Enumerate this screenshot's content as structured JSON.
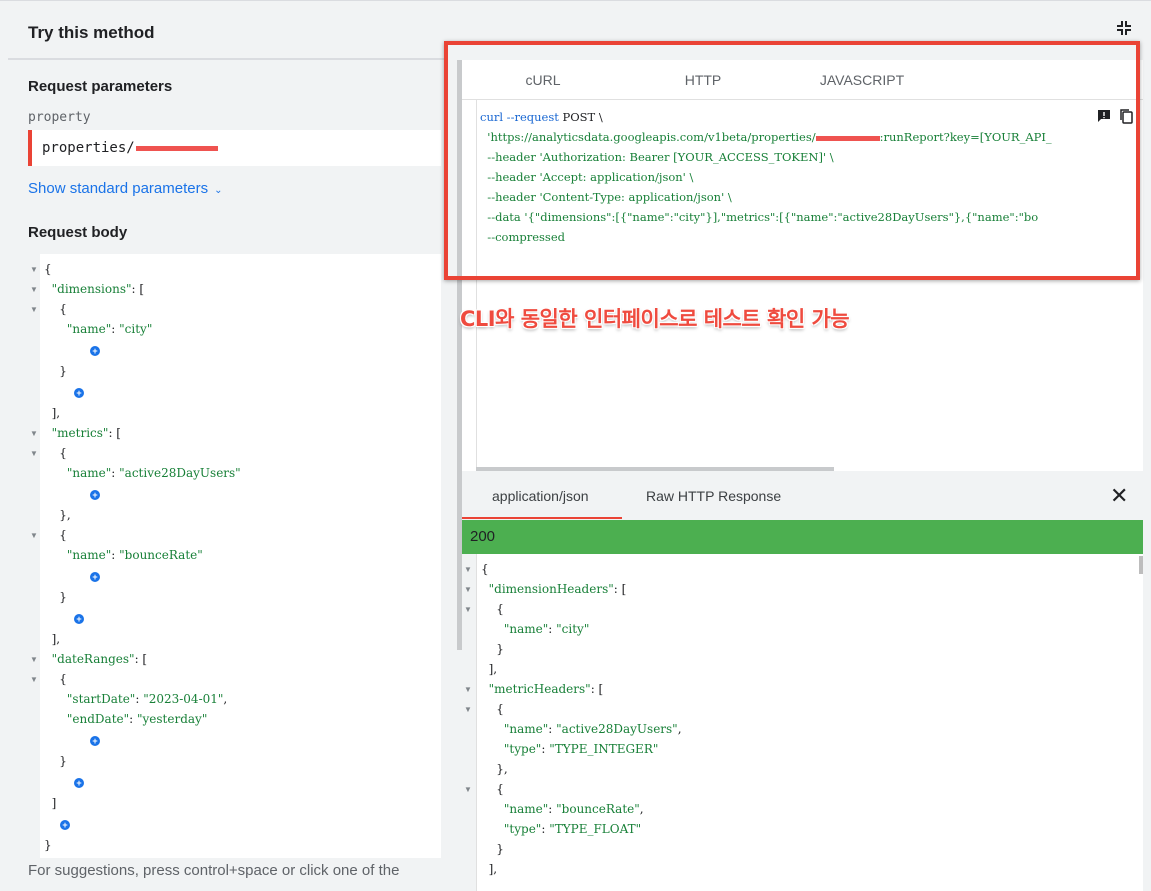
{
  "header": {
    "title": "Try this method",
    "collapse_icon": "fullscreen-exit-icon"
  },
  "request_parameters": {
    "title": "Request parameters",
    "param_name": "property",
    "param_value": "properties/",
    "show_standard_label": "Show standard parameters",
    "chevron_icon": "chevron-down-icon"
  },
  "request_body": {
    "title": "Request body",
    "lines": [
      "{",
      "  \"dimensions\": [",
      "    {",
      "      \"name\": \"city\"",
      "    }",
      "  ],",
      "  \"metrics\": [",
      "    {",
      "      \"name\": \"active28DayUsers\"",
      "    },",
      "    {",
      "      \"name\": \"bounceRate\"",
      "    }",
      "  ],",
      "  \"dateRanges\": [",
      "    {",
      "      \"startDate\": \"2023-04-01\",",
      "      \"endDate\": \"yesterday\"",
      "    }",
      "  ]",
      "}"
    ],
    "hint": "For suggestions, press control+space or click one of the"
  },
  "code_tabs": [
    "cURL",
    "HTTP",
    "JAVASCRIPT"
  ],
  "code_icons": [
    "feedback-icon",
    "copy-icon"
  ],
  "curl_lines": [
    "curl --request POST \\",
    "  'https://analyticsdata.googleapis.com/v1beta/properties/",
    ":runReport?key=[YOUR_API_",
    "  --header 'Authorization: Bearer [YOUR_ACCESS_TOKEN]' \\",
    "  --header 'Accept: application/json' \\",
    "  --header 'Content-Type: application/json' \\",
    "  --data '{\"dimensions\":[{\"name\":\"city\"}],\"metrics\":[{\"name\":\"active28DayUsers\"},{\"name\":\"bo",
    "  --compressed"
  ],
  "annotation": "CLI와 동일한 인터페이스로 테스트 확인 가능",
  "response": {
    "tabs": [
      "application/json",
      "Raw HTTP Response"
    ],
    "close_icon": "close-icon",
    "status": "200",
    "lines": [
      "{",
      "  \"dimensionHeaders\": [",
      "    {",
      "      \"name\": \"city\"",
      "    }",
      "  ],",
      "  \"metricHeaders\": [",
      "    {",
      "      \"name\": \"active28DayUsers\",",
      "      \"type\": \"TYPE_INTEGER\"",
      "    },",
      "    {",
      "      \"name\": \"bounceRate\",",
      "      \"type\": \"TYPE_FLOAT\"",
      "    }",
      "  ],"
    ]
  },
  "colors": {
    "accent": "#1a73e8",
    "highlight": "#ea4335",
    "success": "#4caf50",
    "string": "#188038"
  }
}
